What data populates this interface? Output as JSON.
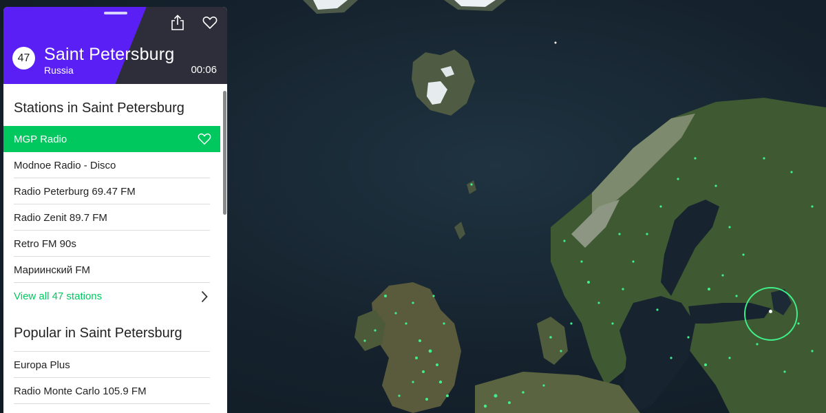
{
  "header": {
    "station_count": "47",
    "city": "Saint Petersburg",
    "country": "Russia",
    "time": "00:06",
    "share_icon": "share-icon",
    "favorite_icon": "heart-icon"
  },
  "stations_section": {
    "title": "Stations in Saint Petersburg",
    "items": [
      {
        "label": "MGP Radio",
        "active": true
      },
      {
        "label": "Modnoe Radio - Disco"
      },
      {
        "label": "Radio Peterburg 69.47 FM"
      },
      {
        "label": "Radio Zenit 89.7 FM"
      },
      {
        "label": "Retro FM 90s"
      },
      {
        "label": "Мариинский FM"
      }
    ],
    "view_all_label": "View all 47 stations"
  },
  "popular_section": {
    "title": "Popular in Saint Petersburg",
    "items": [
      {
        "label": "Europa Plus"
      },
      {
        "label": "Radio Monte Carlo 105.9 FM"
      }
    ]
  },
  "colors": {
    "accent_green": "#00c85f",
    "header_purple": "#5a1ff5",
    "marker": "#3ff08a"
  }
}
